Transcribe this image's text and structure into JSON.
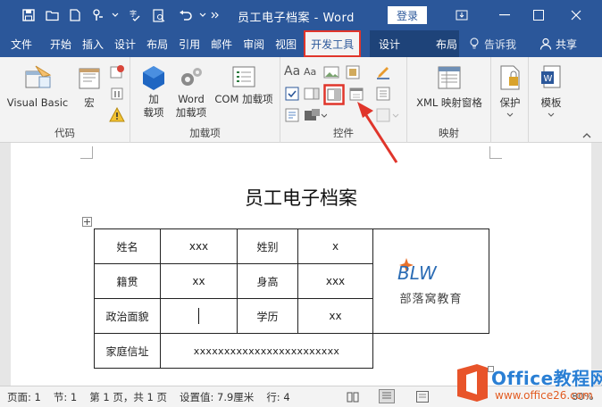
{
  "window": {
    "title": "员工电子档案 - Word",
    "login_label": "登录"
  },
  "tabs": [
    {
      "label": "文件"
    },
    {
      "label": "开始"
    },
    {
      "label": "插入"
    },
    {
      "label": "设计"
    },
    {
      "label": "布局"
    },
    {
      "label": "引用"
    },
    {
      "label": "邮件"
    },
    {
      "label": "审阅"
    },
    {
      "label": "视图"
    },
    {
      "label": "开发工具",
      "active": true
    }
  ],
  "context_tabs": [
    {
      "label": "设计"
    },
    {
      "label": "布局"
    }
  ],
  "tell_me": "告诉我",
  "share": "共享",
  "ribbon": {
    "code": {
      "label": "代码",
      "visual_basic": "Visual Basic",
      "macro": "宏"
    },
    "addins": {
      "label": "加载项",
      "addin_line1": "加",
      "addin_line2": "载项",
      "word_addin_line1": "Word",
      "word_addin_line2": "加载项",
      "com_addin": "COM 加载项"
    },
    "controls": {
      "label": "控件"
    },
    "mapping": {
      "label": "映射",
      "xml_pane": "XML 映射窗格"
    },
    "protect": {
      "label": "保护"
    },
    "templates": {
      "label": "模板"
    }
  },
  "document": {
    "heading": "员工电子档案",
    "table": {
      "row1": [
        "姓名",
        "xxx",
        "姓别",
        "x"
      ],
      "row2": [
        "籍贯",
        "xx",
        "身高",
        "xxx"
      ],
      "row3": [
        "政治面貌",
        "",
        "学历",
        "xx"
      ],
      "row4": [
        "家庭信址",
        "xxxxxxxxxxxxxxxxxxxxxxxx"
      ],
      "logo_text": "BLW",
      "logo_caption": "部落窝教育"
    }
  },
  "statusbar": {
    "page": "页面: 1",
    "section": "节: 1",
    "page_of": "第 1 页，共 1 页",
    "setting": "设置值: 7.9厘米",
    "line": "行: 4",
    "zoom": "80%"
  },
  "watermark": {
    "brand": "Office教程网",
    "url": "www.office26.com"
  },
  "colors": {
    "accent": "#2b579a",
    "highlight": "#e0352b"
  }
}
